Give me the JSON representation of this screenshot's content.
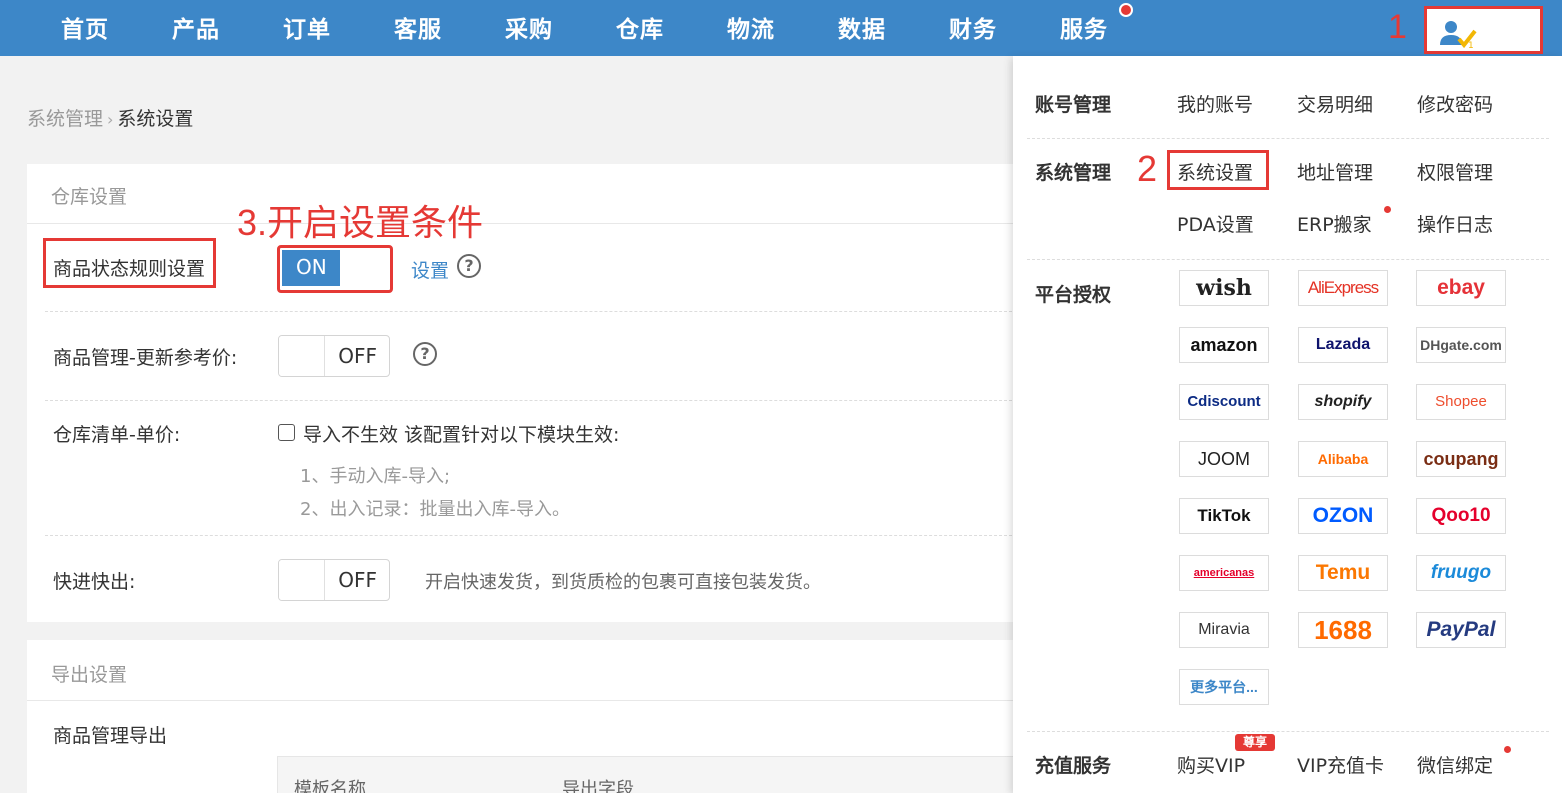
{
  "nav": {
    "items": [
      "首页",
      "产品",
      "订单",
      "客服",
      "采购",
      "仓库",
      "物流",
      "数据",
      "财务",
      "服务"
    ]
  },
  "annotations": {
    "step1": "1",
    "step2": "2",
    "step3": "3.开启设置条件"
  },
  "breadcrumb": {
    "parent": "系统管理",
    "current": "系统设置"
  },
  "warehouse": {
    "title": "仓库设置",
    "rule_label": "商品状态规则设置",
    "rule_toggle": "ON",
    "rule_link": "设置",
    "ref_price_label": "商品管理-更新参考价:",
    "ref_price_toggle": "OFF",
    "unit_price_label": "仓库清单-单价:",
    "unit_price_checkbox": "导入不生效 该配置针对以下模块生效:",
    "unit_price_note1": "1、手动入库-导入;",
    "unit_price_note2": "2、出入记录：批量出入库-导入。",
    "fast_label": "快进快出:",
    "fast_toggle": "OFF",
    "fast_desc": "开启快速发货，到货质检的包裹可直接包装发货。"
  },
  "export": {
    "title": "导出设置",
    "product_export_label": "商品管理导出",
    "columns": [
      "模板名称",
      "导出字段"
    ]
  },
  "dropdown": {
    "account": {
      "title": "账号管理",
      "links": [
        "我的账号",
        "交易明细",
        "修改密码"
      ]
    },
    "system": {
      "title": "系统管理",
      "links": [
        "系统设置",
        "地址管理",
        "权限管理",
        "PDA设置",
        "ERP搬家",
        "操作日志"
      ]
    },
    "platform": {
      "title": "平台授权",
      "logos": [
        "wish",
        "AliExpress",
        "ebay",
        "amazon",
        "Lazada",
        "DHgate.com",
        "Cdiscount",
        "shopify",
        "Shopee",
        "JOOM",
        "Alibaba",
        "coupang",
        "TikTok",
        "OZON",
        "Qoo10",
        "americanas",
        "Temu",
        "fruugo",
        "Miravia",
        "1688",
        "PayPal",
        "更多平台..."
      ]
    },
    "recharge": {
      "title": "充值服务",
      "links": [
        "购买VIP",
        "VIP充值卡",
        "微信绑定"
      ],
      "badge": "尊享"
    }
  },
  "colors": {
    "nav_bg": "#3d87c8",
    "annotation_red": "#e53935",
    "link_blue": "#3d87c8"
  }
}
